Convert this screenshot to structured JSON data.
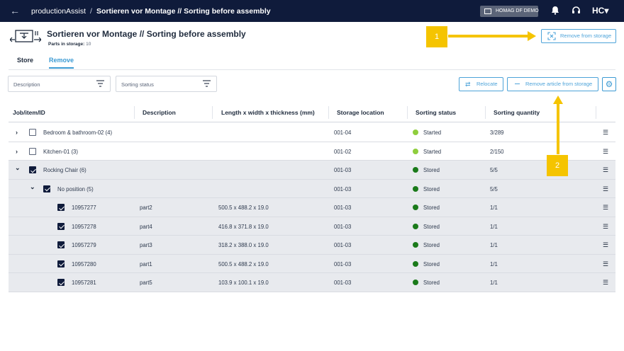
{
  "topbar": {
    "app": "productionAssist",
    "separator": "/",
    "page": "Sortieren vor Montage // Sorting before assembly",
    "tenant": "HOMAG DF DEMO",
    "logo": "HC▾"
  },
  "header": {
    "title": "Sortieren vor Montage // Sorting before assembly",
    "parts_label": "Parts in storage:",
    "parts_count": "10",
    "remove_from_storage": "Remove from storage"
  },
  "tabs": [
    {
      "label": "Store"
    },
    {
      "label": "Remove"
    }
  ],
  "filters": {
    "description": "Description",
    "sorting_status": "Sorting status"
  },
  "actions": {
    "relocate": "Relocate",
    "remove_article": "Remove article from storage"
  },
  "columns": [
    "Job/item/ID",
    "Description",
    "Length x width x thickness (mm)",
    "Storage location",
    "Sorting status",
    "Sorting quantity"
  ],
  "rows": [
    {
      "id": "Bedroom & bathroom-02 (4)",
      "desc": "",
      "dims": "",
      "loc": "001-04",
      "status": "Started",
      "qty": "3/289"
    },
    {
      "id": "Kitchen-01 (3)",
      "desc": "",
      "dims": "",
      "loc": "001-02",
      "status": "Started",
      "qty": "2/150"
    },
    {
      "id": "Rocking Chair (6)",
      "desc": "",
      "dims": "",
      "loc": "001-03",
      "status": "Stored",
      "qty": "5/5"
    },
    {
      "id": "No position (5)",
      "desc": "",
      "dims": "",
      "loc": "001-03",
      "status": "Stored",
      "qty": "5/5"
    },
    {
      "id": "10957277",
      "desc": "part2",
      "dims": "500.5 x 488.2 x 19.0",
      "loc": "001-03",
      "status": "Stored",
      "qty": "1/1"
    },
    {
      "id": "10957278",
      "desc": "part4",
      "dims": "416.8 x 371.8 x 19.0",
      "loc": "001-03",
      "status": "Stored",
      "qty": "1/1"
    },
    {
      "id": "10957279",
      "desc": "part3",
      "dims": "318.2 x 388.0 x 19.0",
      "loc": "001-03",
      "status": "Stored",
      "qty": "1/1"
    },
    {
      "id": "10957280",
      "desc": "part1",
      "dims": "500.5 x 488.2 x 19.0",
      "loc": "001-03",
      "status": "Stored",
      "qty": "1/1"
    },
    {
      "id": "10957281",
      "desc": "part5",
      "dims": "103.9 x 100.1 x 19.0",
      "loc": "001-03",
      "status": "Stored",
      "qty": "1/1"
    }
  ],
  "annotations": {
    "one": "1",
    "two": "2"
  },
  "colors": {
    "topbar": "#0f1b3b",
    "accent": "#3b9ad3",
    "started": "#8fce3d",
    "stored": "#1a7a1a",
    "callout": "#f5c400"
  },
  "icons": {
    "back": "←",
    "chevron_right": "›",
    "chevron_down": "⌄",
    "row_menu": "☰",
    "settings": "⚙"
  }
}
